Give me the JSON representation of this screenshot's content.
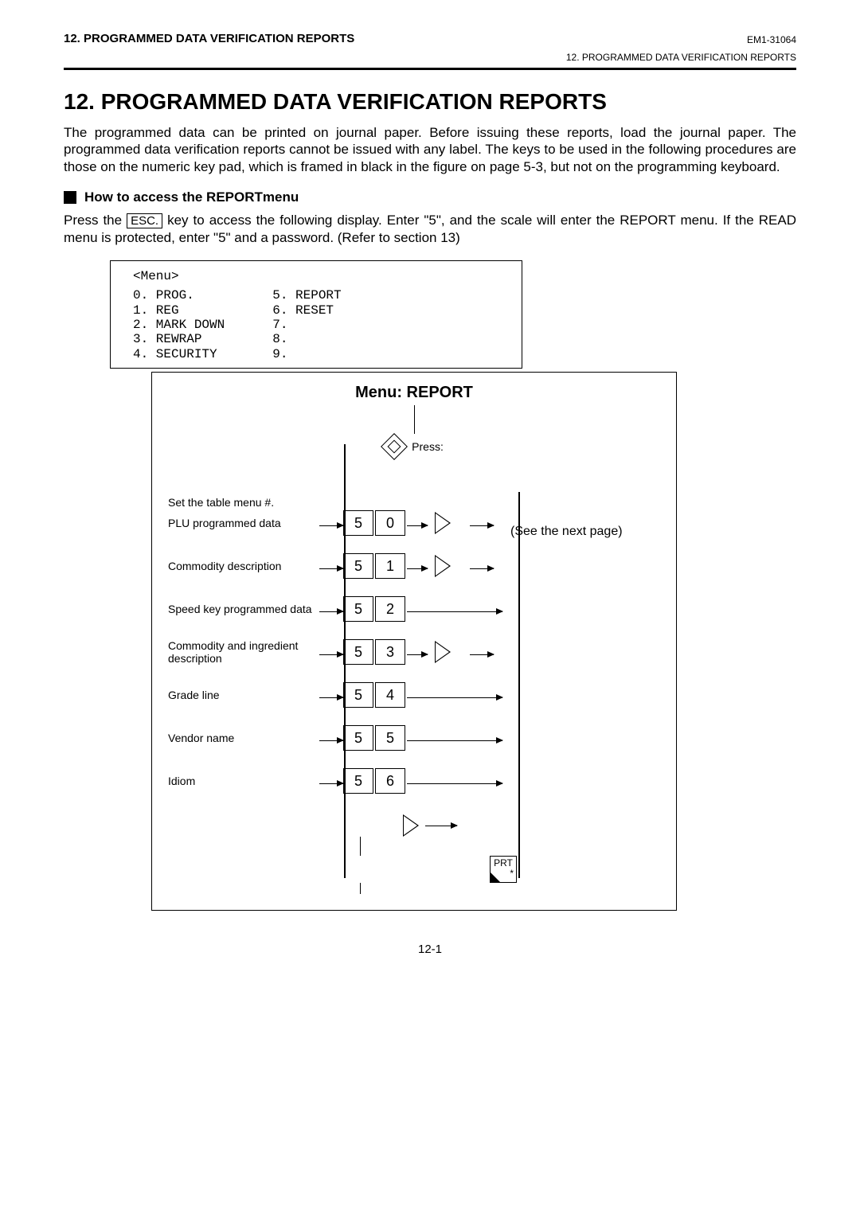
{
  "header": {
    "left": "12.  PROGRAMMED DATA VERIFICATION REPORTS",
    "right": "EM1-31064",
    "breadcrumb": "12. PROGRAMMED DATA VERIFICATION REPORTS"
  },
  "title": "12.  PROGRAMMED DATA VERIFICATION REPORTS",
  "para1": "The programmed data can be printed on journal paper.  Before issuing these reports, load the journal paper.  The programmed data verification reports cannot be issued with any label.  The keys to be used in the following procedures are those on the numeric key pad, which is framed in black in the figure on page 5-3, but not on the programming keyboard.",
  "subhead": "How to access the REPORTmenu",
  "para2a": "Press the ",
  "esc_key": "ESC.",
  "para2b": " key to access the following display.  Enter \"5\", and the scale will enter the REPORT menu.  If the READ menu is protected, enter \"5\" and a password.  (Refer to section 13)",
  "menu": {
    "title": "<Menu>",
    "left": [
      "0. PROG.",
      "1. REG",
      "2. MARK DOWN",
      "3. REWRAP",
      "4. SECURITY"
    ],
    "right": [
      "5. REPORT",
      "6. RESET",
      "7.",
      "8.",
      "9."
    ]
  },
  "flow": {
    "title": "Menu:  REPORT",
    "press": "Press:",
    "set_note": "Set the table menu #.",
    "next_page": "(See the next page)",
    "rows": [
      {
        "label": "PLU programmed data",
        "d1": "5",
        "d2": "0",
        "tri": "u"
      },
      {
        "label": "Commodity description",
        "d1": "5",
        "d2": "1",
        "tri": "u"
      },
      {
        "label": "Speed key programmed data",
        "d1": "5",
        "d2": "2",
        "tri": ""
      },
      {
        "label": "Commodity and ingredient description",
        "d1": "5",
        "d2": "3",
        "tri": "u"
      },
      {
        "label": "Grade line",
        "d1": "5",
        "d2": "4",
        "tri": ""
      },
      {
        "label": "Vendor name",
        "d1": "5",
        "d2": "5",
        "tri": ""
      },
      {
        "label": "Idiom",
        "d1": "5",
        "d2": "6",
        "tri": ""
      }
    ],
    "v_label": "v",
    "prt_top": "PRT",
    "prt_bottom": "*"
  },
  "page_footer": "12-1"
}
